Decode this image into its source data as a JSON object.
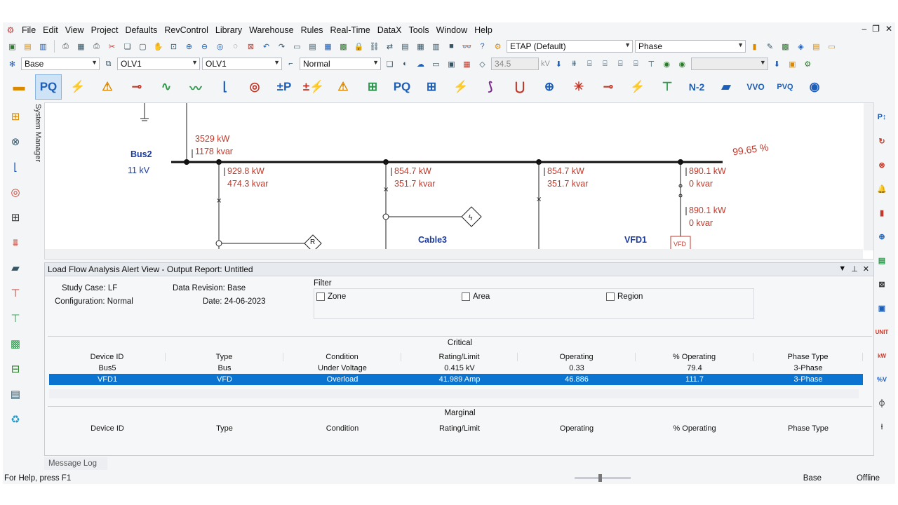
{
  "menu": [
    "File",
    "Edit",
    "View",
    "Project",
    "Defaults",
    "RevControl",
    "Library",
    "Warehouse",
    "Rules",
    "Real-Time",
    "DataX",
    "Tools",
    "Window",
    "Help"
  ],
  "toolbar1": {
    "presentation": "ETAP (Default)",
    "display": "Phase"
  },
  "toolbar2": {
    "base": "Base",
    "olv_left": "OLV1",
    "olv_right": "OLV1",
    "mode": "Normal",
    "kv_value": "34.5",
    "kv_unit": "kV"
  },
  "toolbar3": {
    "n2_label": "N-2",
    "vvo_label": "VVO",
    "pvq_label": "PVQ"
  },
  "system_manager": "System Manager",
  "diagram": {
    "bus_name": "Bus2",
    "bus_voltage": "11 kV",
    "percent": "99.65 %",
    "source_kw": "3529 kW",
    "source_kvar": "1178 kvar",
    "branches": [
      {
        "kw": "929.8 kW",
        "kvar": "474.3 kvar"
      },
      {
        "kw": "854.7 kW",
        "kvar": "351.7 kvar"
      },
      {
        "kw": "854.7 kW",
        "kvar": "351.7 kvar"
      },
      {
        "kw": "890.1 kW",
        "kvar": "0 kvar"
      }
    ],
    "lower_flow_kw": "890.1 kW",
    "lower_flow_kvar": "0 kvar",
    "cable_label": "Cable3",
    "vfd_label": "VFD1",
    "vfd_box": "VFD",
    "r_box": "R"
  },
  "panel": {
    "title": "Load Flow Analysis Alert View - Output Report: Untitled",
    "study_case": "Study Case: LF",
    "configuration": "Configuration: Normal",
    "data_revision": "Data Revision: Base",
    "date": "Date: 24-06-2023",
    "filter_label": "Filter",
    "filters": [
      "Zone",
      "Area",
      "Region"
    ],
    "critical_label": "Critical",
    "marginal_label": "Marginal",
    "columns": [
      "Device ID",
      "Type",
      "Condition",
      "Rating/Limit",
      "Operating",
      "% Operating",
      "Phase Type"
    ],
    "critical_rows": [
      [
        "Bus5",
        "Bus",
        "Under Voltage",
        "0.415 kV",
        "0.33",
        "79.4",
        "3-Phase"
      ],
      [
        "VFD1",
        "VFD",
        "Overload",
        "41.989 Amp",
        "46.886",
        "111.7",
        "3-Phase"
      ]
    ]
  },
  "message_log": "Message Log",
  "status": {
    "help": "For Help, press F1",
    "base": "Base",
    "mode": "Offline"
  },
  "colors": {
    "flow_text": "#c0392b",
    "bus_text": "#1a3aa0",
    "selection": "#0a74d0"
  }
}
